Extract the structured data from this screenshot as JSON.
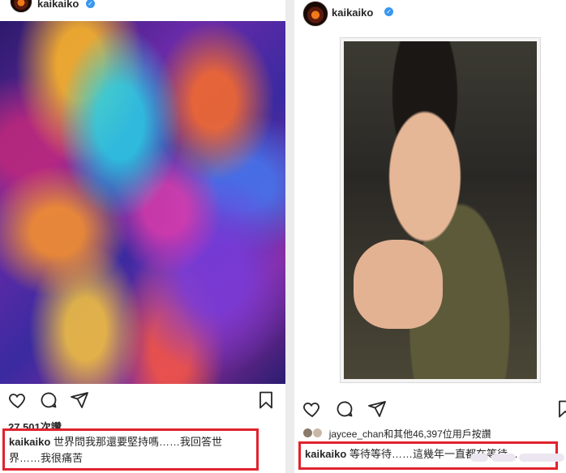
{
  "left_post": {
    "username": "kaikaiko",
    "verified_mark": "✓",
    "likes": "27,501次讚",
    "caption": {
      "username": "kaikaiko",
      "text": "世界問我那還要堅持嗎……我回答世界……我很痛苦"
    },
    "icons": [
      "heart-icon",
      "comment-icon",
      "share-icon",
      "bookmark-icon"
    ]
  },
  "right_post": {
    "username": "kaikaiko",
    "verified_mark": "✓",
    "liked_by": "jaycee_chan和其他46,397位用戶按讚",
    "caption": {
      "username": "kaikaiko",
      "text": "等待等待……這幾年一直都在等待……"
    },
    "icons": [
      "heart-icon",
      "comment-icon",
      "share-icon",
      "bookmark-icon"
    ]
  },
  "colors": {
    "highlight_box": "#e0232e",
    "verified": "#3897f0",
    "text": "#262626"
  }
}
